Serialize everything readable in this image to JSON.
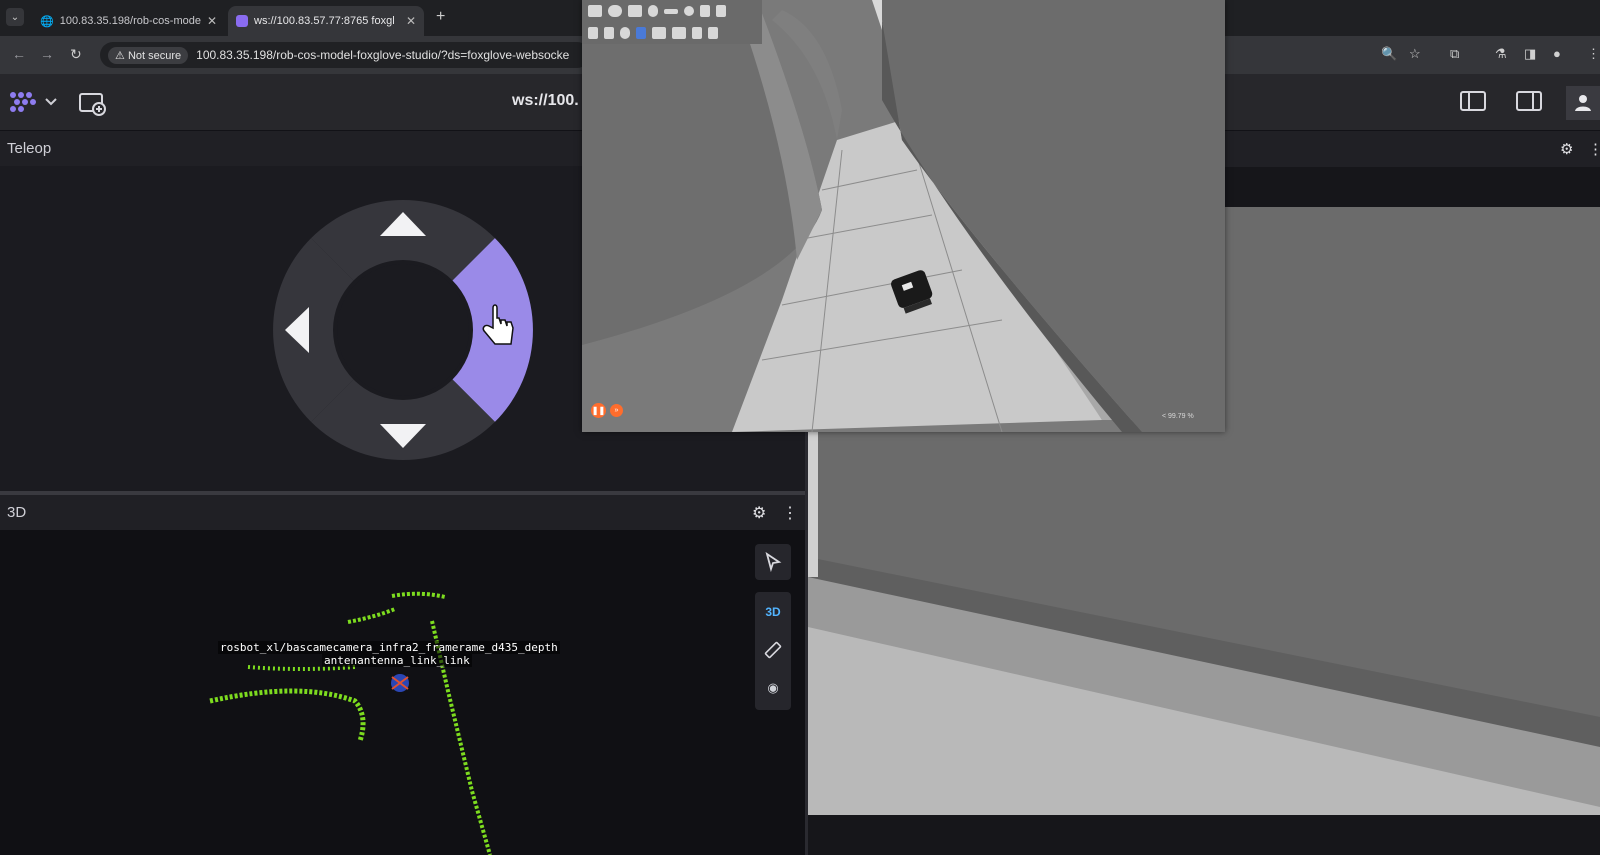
{
  "browser": {
    "tabs": [
      {
        "label": "100.83.35.198/rob-cos-mode",
        "active": false
      },
      {
        "label": "ws://100.83.57.77:8765 foxgl",
        "active": true
      }
    ],
    "security_label": "Not secure",
    "url": "100.83.35.198/rob-cos-model-foxglove-studio/?ds=foxglove-websocke"
  },
  "app": {
    "connection_label": "ws://100."
  },
  "teleop": {
    "title": "Teleop",
    "active_direction": "right",
    "accent": "#9a8ae8"
  },
  "three_d": {
    "title": "3D",
    "mode_label": "3D",
    "frame_label_1": "rosbot_xl/bascamecamera_infra2_framerame_d435_depth",
    "frame_label_2": "antenantenna_link_link",
    "pointcloud_color": "#7ddc1f"
  },
  "gazebo": {
    "status_text": "< 99.79 %"
  }
}
